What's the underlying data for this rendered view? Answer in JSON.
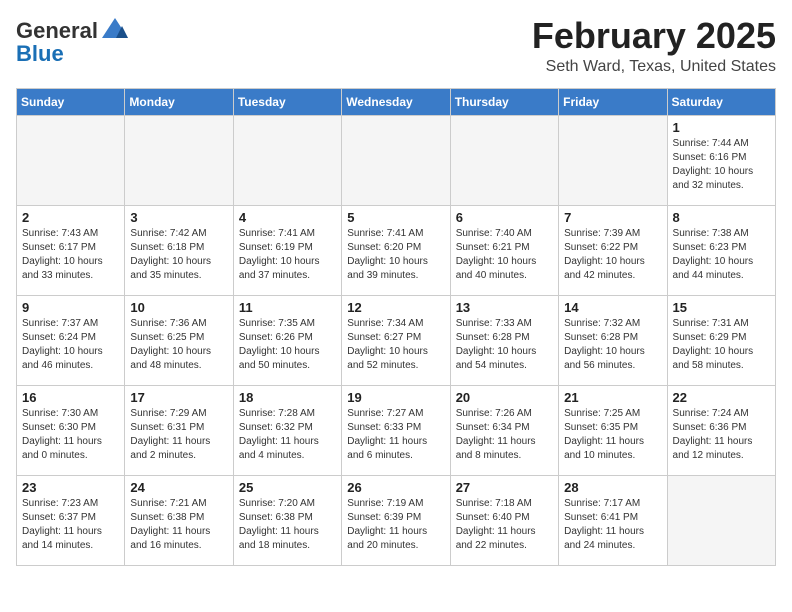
{
  "header": {
    "logo_general": "General",
    "logo_blue": "Blue",
    "month_title": "February 2025",
    "location": "Seth Ward, Texas, United States"
  },
  "weekdays": [
    "Sunday",
    "Monday",
    "Tuesday",
    "Wednesday",
    "Thursday",
    "Friday",
    "Saturday"
  ],
  "weeks": [
    [
      {
        "day": "",
        "info": ""
      },
      {
        "day": "",
        "info": ""
      },
      {
        "day": "",
        "info": ""
      },
      {
        "day": "",
        "info": ""
      },
      {
        "day": "",
        "info": ""
      },
      {
        "day": "",
        "info": ""
      },
      {
        "day": "1",
        "info": "Sunrise: 7:44 AM\nSunset: 6:16 PM\nDaylight: 10 hours\nand 32 minutes."
      }
    ],
    [
      {
        "day": "2",
        "info": "Sunrise: 7:43 AM\nSunset: 6:17 PM\nDaylight: 10 hours\nand 33 minutes."
      },
      {
        "day": "3",
        "info": "Sunrise: 7:42 AM\nSunset: 6:18 PM\nDaylight: 10 hours\nand 35 minutes."
      },
      {
        "day": "4",
        "info": "Sunrise: 7:41 AM\nSunset: 6:19 PM\nDaylight: 10 hours\nand 37 minutes."
      },
      {
        "day": "5",
        "info": "Sunrise: 7:41 AM\nSunset: 6:20 PM\nDaylight: 10 hours\nand 39 minutes."
      },
      {
        "day": "6",
        "info": "Sunrise: 7:40 AM\nSunset: 6:21 PM\nDaylight: 10 hours\nand 40 minutes."
      },
      {
        "day": "7",
        "info": "Sunrise: 7:39 AM\nSunset: 6:22 PM\nDaylight: 10 hours\nand 42 minutes."
      },
      {
        "day": "8",
        "info": "Sunrise: 7:38 AM\nSunset: 6:23 PM\nDaylight: 10 hours\nand 44 minutes."
      }
    ],
    [
      {
        "day": "9",
        "info": "Sunrise: 7:37 AM\nSunset: 6:24 PM\nDaylight: 10 hours\nand 46 minutes."
      },
      {
        "day": "10",
        "info": "Sunrise: 7:36 AM\nSunset: 6:25 PM\nDaylight: 10 hours\nand 48 minutes."
      },
      {
        "day": "11",
        "info": "Sunrise: 7:35 AM\nSunset: 6:26 PM\nDaylight: 10 hours\nand 50 minutes."
      },
      {
        "day": "12",
        "info": "Sunrise: 7:34 AM\nSunset: 6:27 PM\nDaylight: 10 hours\nand 52 minutes."
      },
      {
        "day": "13",
        "info": "Sunrise: 7:33 AM\nSunset: 6:28 PM\nDaylight: 10 hours\nand 54 minutes."
      },
      {
        "day": "14",
        "info": "Sunrise: 7:32 AM\nSunset: 6:28 PM\nDaylight: 10 hours\nand 56 minutes."
      },
      {
        "day": "15",
        "info": "Sunrise: 7:31 AM\nSunset: 6:29 PM\nDaylight: 10 hours\nand 58 minutes."
      }
    ],
    [
      {
        "day": "16",
        "info": "Sunrise: 7:30 AM\nSunset: 6:30 PM\nDaylight: 11 hours\nand 0 minutes."
      },
      {
        "day": "17",
        "info": "Sunrise: 7:29 AM\nSunset: 6:31 PM\nDaylight: 11 hours\nand 2 minutes."
      },
      {
        "day": "18",
        "info": "Sunrise: 7:28 AM\nSunset: 6:32 PM\nDaylight: 11 hours\nand 4 minutes."
      },
      {
        "day": "19",
        "info": "Sunrise: 7:27 AM\nSunset: 6:33 PM\nDaylight: 11 hours\nand 6 minutes."
      },
      {
        "day": "20",
        "info": "Sunrise: 7:26 AM\nSunset: 6:34 PM\nDaylight: 11 hours\nand 8 minutes."
      },
      {
        "day": "21",
        "info": "Sunrise: 7:25 AM\nSunset: 6:35 PM\nDaylight: 11 hours\nand 10 minutes."
      },
      {
        "day": "22",
        "info": "Sunrise: 7:24 AM\nSunset: 6:36 PM\nDaylight: 11 hours\nand 12 minutes."
      }
    ],
    [
      {
        "day": "23",
        "info": "Sunrise: 7:23 AM\nSunset: 6:37 PM\nDaylight: 11 hours\nand 14 minutes."
      },
      {
        "day": "24",
        "info": "Sunrise: 7:21 AM\nSunset: 6:38 PM\nDaylight: 11 hours\nand 16 minutes."
      },
      {
        "day": "25",
        "info": "Sunrise: 7:20 AM\nSunset: 6:38 PM\nDaylight: 11 hours\nand 18 minutes."
      },
      {
        "day": "26",
        "info": "Sunrise: 7:19 AM\nSunset: 6:39 PM\nDaylight: 11 hours\nand 20 minutes."
      },
      {
        "day": "27",
        "info": "Sunrise: 7:18 AM\nSunset: 6:40 PM\nDaylight: 11 hours\nand 22 minutes."
      },
      {
        "day": "28",
        "info": "Sunrise: 7:17 AM\nSunset: 6:41 PM\nDaylight: 11 hours\nand 24 minutes."
      },
      {
        "day": "",
        "info": ""
      }
    ]
  ]
}
